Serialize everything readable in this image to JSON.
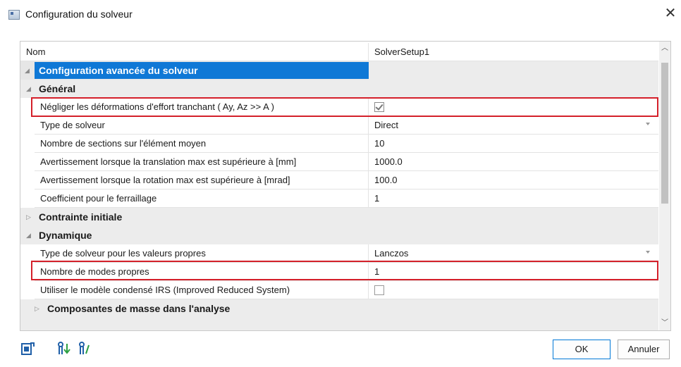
{
  "window": {
    "title": "Configuration du solveur",
    "close_symbol": "✕"
  },
  "header": {
    "name_label": "Nom",
    "name_value": "SolverSetup1"
  },
  "sections": {
    "advanced": "Configuration avancée du solveur",
    "general": "Général",
    "initial_stress": "Contrainte initiale",
    "dynamics": "Dynamique",
    "mass_components": "Composantes de masse dans l'analyse"
  },
  "general_props": [
    {
      "label": "Négliger les déformations d'effort tranchant ( Ay, Az >> A )",
      "value": "",
      "checked": true
    },
    {
      "label": "Type de solveur",
      "value": "Direct"
    },
    {
      "label": "Nombre de sections sur l'élément moyen",
      "value": "10"
    },
    {
      "label": "Avertissement lorsque la translation max est supérieure à [mm]",
      "value": "1000.0"
    },
    {
      "label": "Avertissement lorsque la rotation max est supérieure à [mrad]",
      "value": "100.0"
    },
    {
      "label": "Coefficient pour le ferraillage",
      "value": "1"
    }
  ],
  "dynamics_props": [
    {
      "label": "Type de solveur pour les valeurs propres",
      "value": "Lanczos"
    },
    {
      "label": "Nombre de modes propres",
      "value": "1"
    },
    {
      "label": "Utiliser le modèle condensé IRS (Improved Reduced System)",
      "value": "",
      "checked": false
    }
  ],
  "footer": {
    "ok_label": "OK",
    "cancel_label": "Annuler"
  },
  "icons": [
    "export-icon",
    "sort-down-icon",
    "sort-up-icon",
    "chevron-up-icon",
    "chevron-down-icon"
  ],
  "colors": {
    "selection": "#0f78d6",
    "highlight_border": "#d4202a"
  }
}
